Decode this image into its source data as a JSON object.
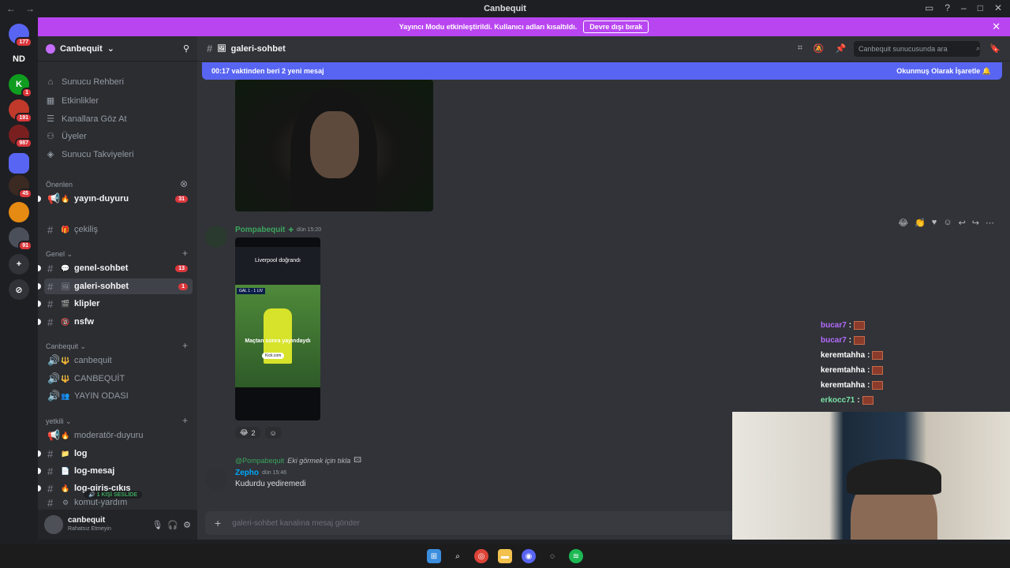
{
  "window": {
    "title": "Canbequit"
  },
  "banner": {
    "text": "Yayıncı Modu etkinleştirildi. Kullanıcı adları kısaltıldı.",
    "button": "Devre dışı bırak"
  },
  "servers": [
    {
      "label": "",
      "badge": "177",
      "color": "#5865f2"
    },
    {
      "label": "ND",
      "badge": "",
      "color": "#1e1f22"
    },
    {
      "label": "K",
      "badge": "1",
      "color": "#0f9d1f"
    },
    {
      "label": "",
      "badge": "191",
      "color": "#c0392b"
    },
    {
      "label": "",
      "badge": "987",
      "color": "#7a1f1f"
    },
    {
      "label": "",
      "badge": "",
      "color": "#5865f2"
    },
    {
      "label": "",
      "badge": "45",
      "color": "#3b2a22"
    },
    {
      "label": "",
      "badge": "",
      "color": "#e58a12"
    },
    {
      "label": "",
      "badge": "91",
      "color": "#4a4f5a"
    }
  ],
  "sidebar": {
    "server_name": "Canbequit",
    "nav": [
      "Sunucu Rehberi",
      "Etkinlikler",
      "Kanallara Göz At",
      "Üyeler",
      "Sunucu Takviyeleri"
    ],
    "suggested_label": "Önerilen",
    "suggested": {
      "name": "yayın-duyuru",
      "count": "31"
    },
    "cekilis": "çekiliş",
    "cat_genel": "Genel",
    "channels": [
      {
        "name": "genel-sohbet",
        "count": "13"
      },
      {
        "name": "galeri-sohbet",
        "count": "1"
      },
      {
        "name": "klipler",
        "count": ""
      },
      {
        "name": "nsfw",
        "count": ""
      }
    ],
    "cat_canbequit": "Canbequit",
    "voice": [
      "canbequit",
      "CANBEQUİT",
      "YAYIN ODASI"
    ],
    "cat_yetkili": "yetkili",
    "staff": [
      "moderatör-duyuru",
      "log",
      "log-mesaj",
      "log-giriş-çıkış",
      "komut-yardım"
    ],
    "voice_badge": "1 KİŞİ SESLİDE",
    "user": {
      "name": "canbequit",
      "status": "Rahatsız Etmeyin"
    }
  },
  "header": {
    "channel": "galeri-sohbet",
    "search_placeholder": "Canbequit sunucusunda ara"
  },
  "new_messages": {
    "text": "00:17 vaktinden beri 2 yeni mesaj",
    "action": "Okunmuş Olarak İşaretle"
  },
  "messages": [
    {
      "author": "Pompabequit",
      "time": "dün 15:20",
      "video_title": "Liverpool doğrandı",
      "video_caption": "Maçtan sonra yayındaydı",
      "video_score": "GAL 1 - 1 LIV",
      "video_brand": "Kick.com"
    },
    {
      "reply_to": "@Pompabequit",
      "reply_text": "Eki görmek için tıkla",
      "author": "Zepho",
      "time": "dün 15:46",
      "text": "Kudurdu yediremedi"
    }
  ],
  "reactions": [
    {
      "emoji": "😂",
      "count": "2"
    }
  ],
  "composer": {
    "placeholder": "galeri-sohbet kanalına mesaj gönder"
  },
  "stream_chat": [
    {
      "user": "bucar7",
      "color": "#b46bff"
    },
    {
      "user": "bucar7",
      "color": "#b46bff"
    },
    {
      "user": "keremtahha",
      "color": "#ffffff"
    },
    {
      "user": "keremtahha",
      "color": "#ffffff"
    },
    {
      "user": "keremtahha",
      "color": "#ffffff"
    },
    {
      "user": "erkocc71",
      "color": "#7be3a8"
    }
  ]
}
